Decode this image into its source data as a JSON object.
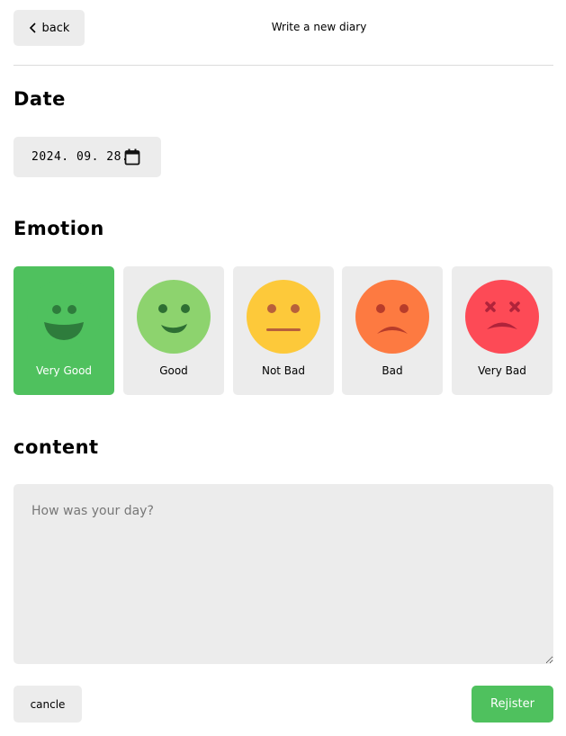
{
  "header": {
    "back_label": "back",
    "title": "Write a new diary"
  },
  "date_section": {
    "title": "Date",
    "value": "2024. 09. 28."
  },
  "emotion_section": {
    "title": "Emotion",
    "selected": "Very Good",
    "items": [
      {
        "label": "Very Good",
        "color": "#4fc15e",
        "icon": "very-good-face-icon"
      },
      {
        "label": "Good",
        "color": "#8dd36e",
        "icon": "good-face-icon"
      },
      {
        "label": "Not Bad",
        "color": "#fdc93a",
        "icon": "not-bad-face-icon"
      },
      {
        "label": "Bad",
        "color": "#fd7a41",
        "icon": "bad-face-icon"
      },
      {
        "label": "Very Bad",
        "color": "#fd4a56",
        "icon": "very-bad-face-icon"
      }
    ]
  },
  "content_section": {
    "title": "content",
    "placeholder": "How was your day?",
    "value": ""
  },
  "footer": {
    "cancel_label": "cancle",
    "register_label": "Rejister"
  },
  "colors": {
    "accent": "#4fc15e",
    "surface": "#ececec"
  }
}
